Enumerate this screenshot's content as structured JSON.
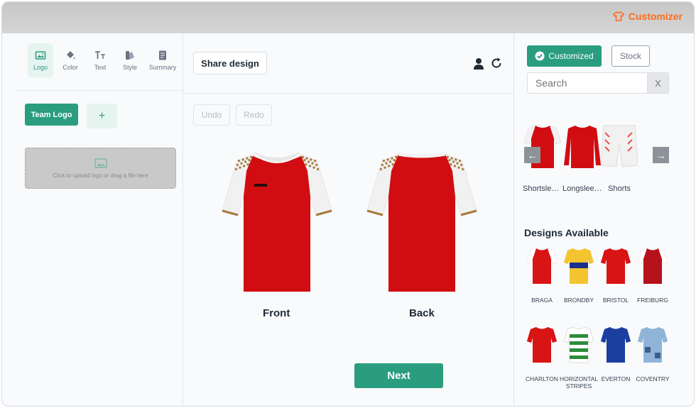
{
  "app": {
    "title": "Customizer",
    "brand_color": "#ff6a1a",
    "accent_color": "#2a9d7f"
  },
  "left_tabs": [
    {
      "label": "Logo",
      "icon": "image-icon",
      "active": true
    },
    {
      "label": "Color",
      "icon": "paint-bucket-icon"
    },
    {
      "label": "Text",
      "icon": "text-size-icon"
    },
    {
      "label": "Style",
      "icon": "swatch-icon"
    },
    {
      "label": "Summary",
      "icon": "document-icon"
    }
  ],
  "logo_panel": {
    "team_logo_label": "Team Logo",
    "add_label": "+",
    "upload_text": "Click to upload logo or drag a file here"
  },
  "canvas": {
    "share_label": "Share design",
    "undo_label": "Undo",
    "redo_label": "Redo",
    "front_label": "Front",
    "back_label": "Back",
    "next_label": "Next"
  },
  "catalog": {
    "customized_label": "Customized",
    "stock_label": "Stock",
    "search_placeholder": "Search",
    "clear_label": "X",
    "categories": [
      {
        "label": "Shortsleeve"
      },
      {
        "label": "Longsleeve"
      },
      {
        "label": "Shorts"
      }
    ],
    "designs_title": "Designs Available",
    "designs": [
      {
        "label": "BRAGA",
        "color": "#d91414",
        "sleeve": "#ffffff"
      },
      {
        "label": "BRONDBY",
        "color": "#f4c430",
        "sleeve": "#f4c430"
      },
      {
        "label": "BRISTOL",
        "color": "#d91414",
        "sleeve": "#d91414"
      },
      {
        "label": "FREIBURG",
        "color": "#b5121b",
        "sleeve": "#ffffff"
      },
      {
        "label": "CHARLTON",
        "color": "#d91414",
        "sleeve": "#d91414"
      },
      {
        "label": "HORIZONTAL STRIPES",
        "color": "#2e8b3a",
        "sleeve": "#ffffff"
      },
      {
        "label": "EVERTON",
        "color": "#1b3fa0",
        "sleeve": "#1b3fa0"
      },
      {
        "label": "COVENTRY",
        "color": "#8fb4d8",
        "sleeve": "#8fb4d8"
      }
    ]
  }
}
